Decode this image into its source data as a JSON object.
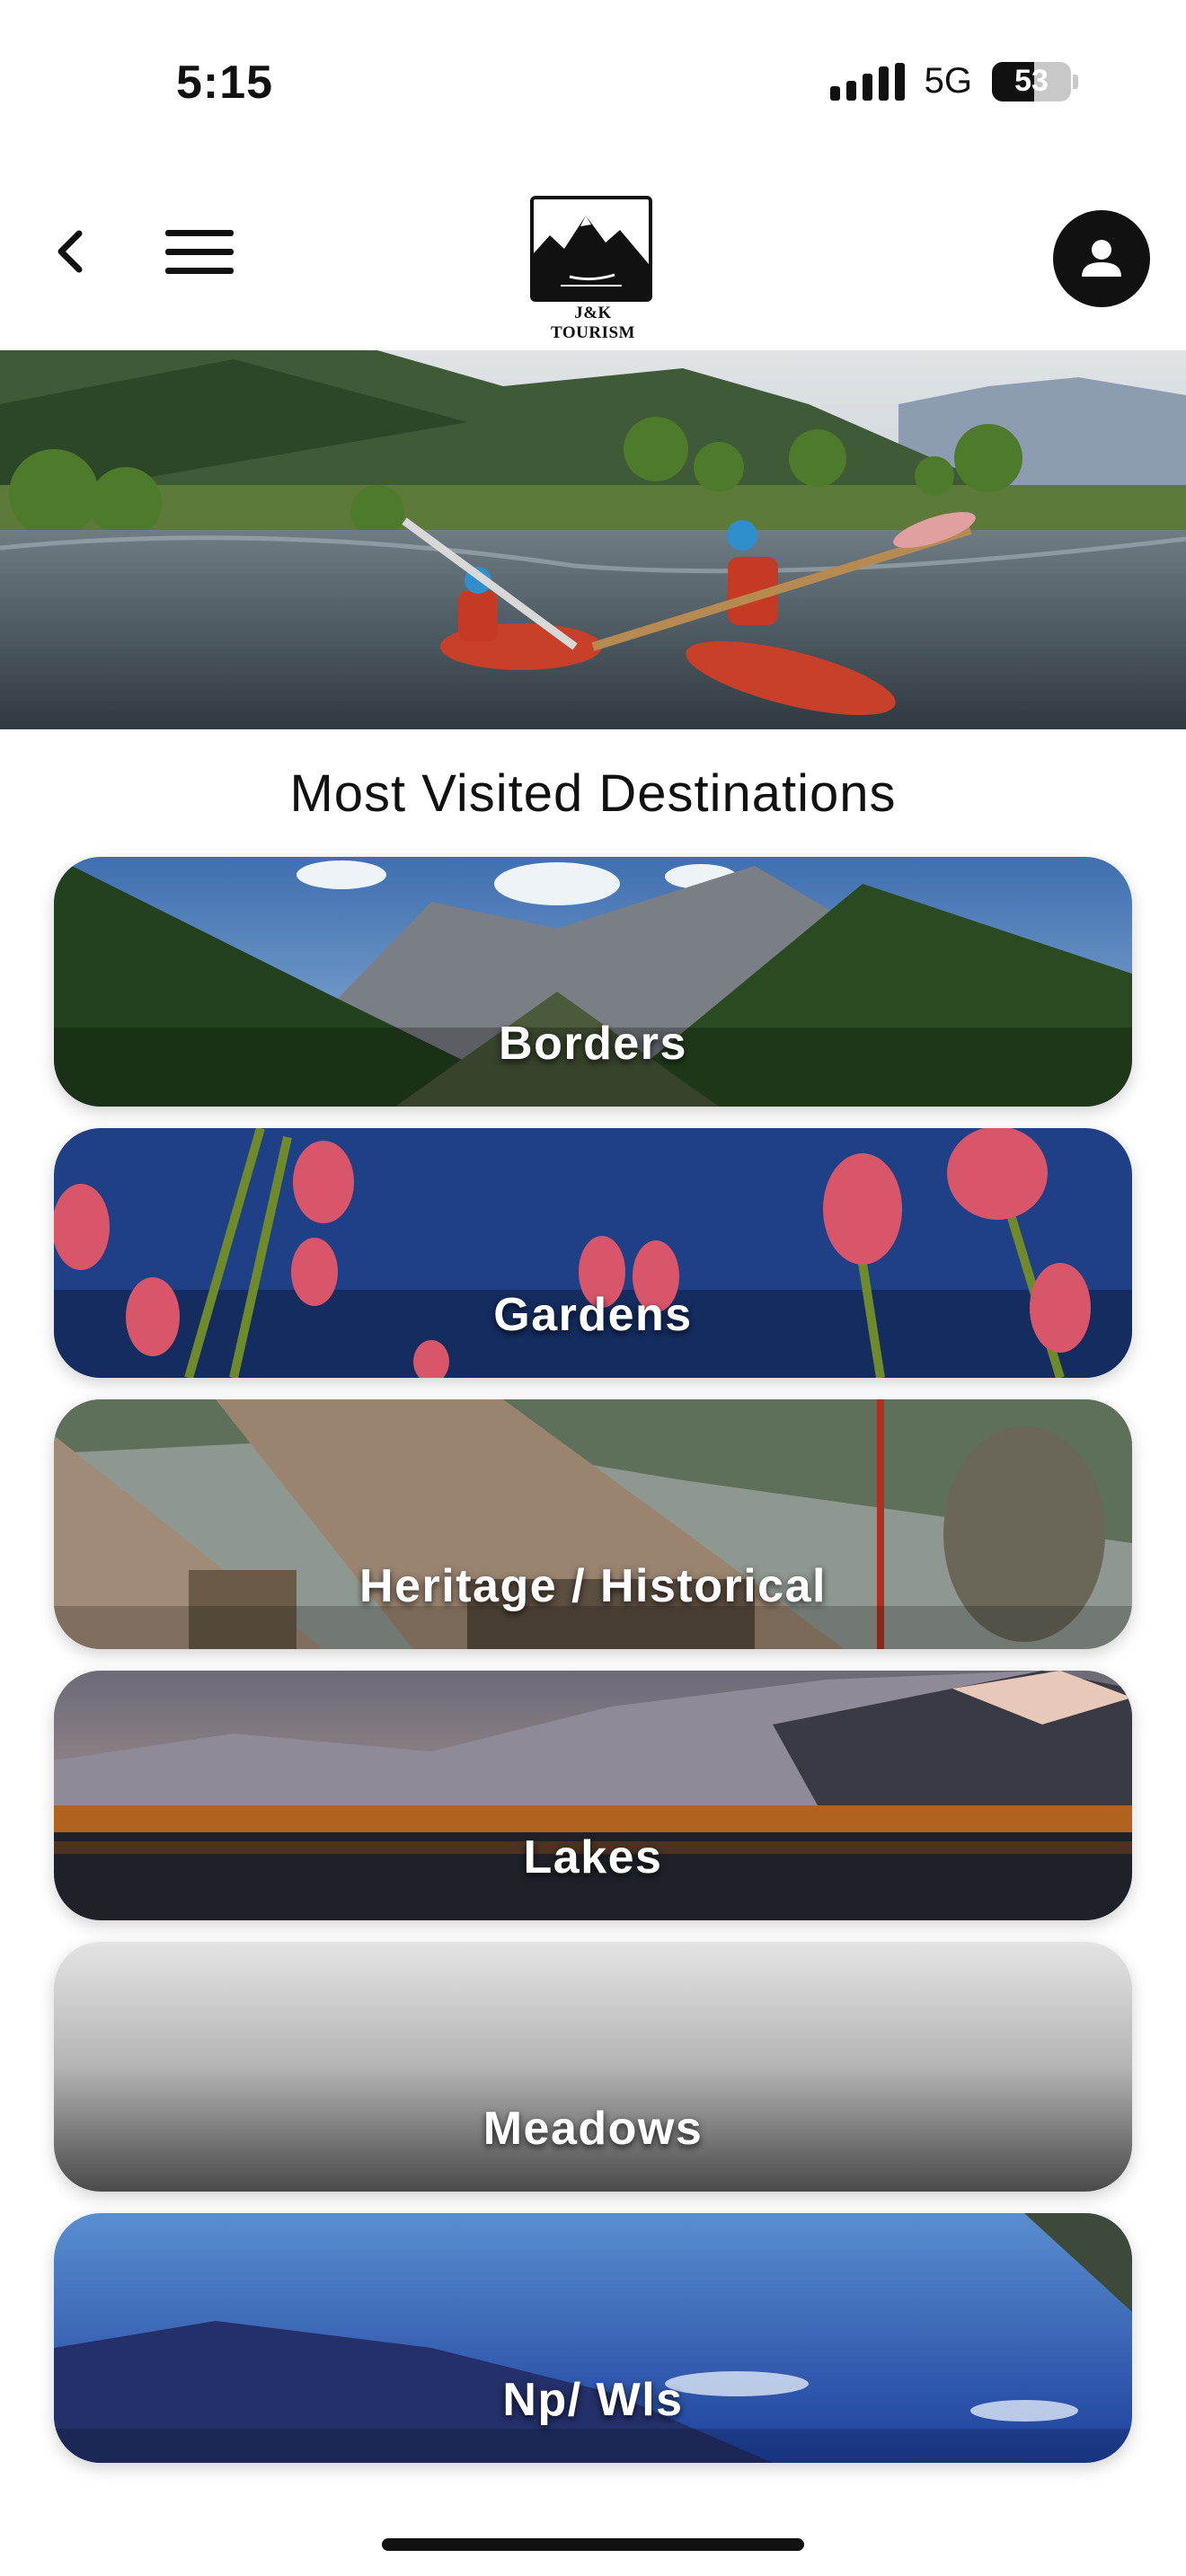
{
  "status_bar": {
    "time": "5:15",
    "network": "5G",
    "battery": "53",
    "battery_level": 0.53
  },
  "nav": {
    "back_icon": "chevron-left-icon",
    "menu_icon": "hamburger-menu-icon",
    "logo_text": "J&K TOURISM",
    "profile_icon": "user-profile-icon"
  },
  "section": {
    "title": "Most Visited Destinations"
  },
  "destinations": [
    {
      "label": "Borders"
    },
    {
      "label": "Gardens"
    },
    {
      "label": "Heritage / Historical"
    },
    {
      "label": "Lakes"
    },
    {
      "label": "Meadows"
    },
    {
      "label": "Np/ Wls"
    }
  ]
}
